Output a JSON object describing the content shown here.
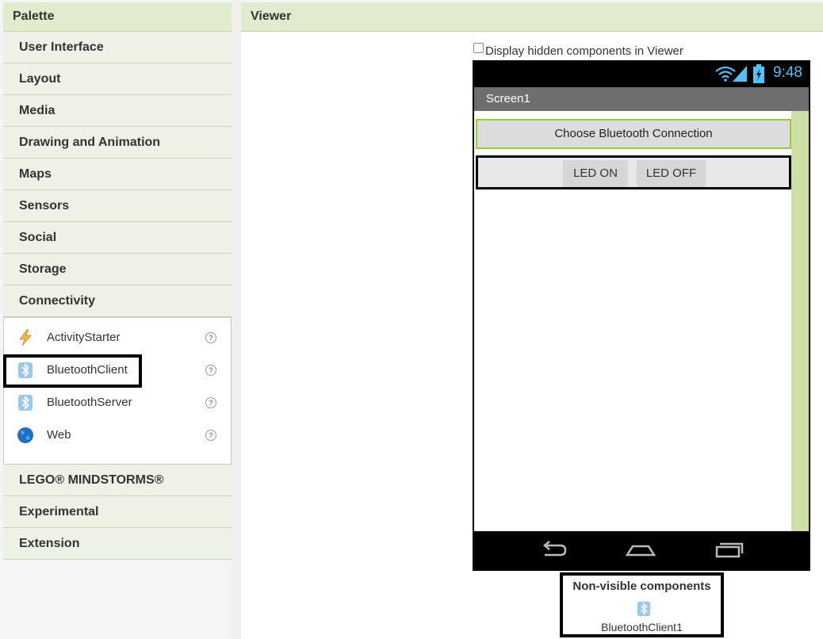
{
  "palette": {
    "title": "Palette",
    "categories_top": [
      "User Interface",
      "Layout",
      "Media",
      "Drawing and Animation",
      "Maps",
      "Sensors",
      "Social",
      "Storage",
      "Connectivity"
    ],
    "connectivity_items": [
      {
        "label": "ActivityStarter",
        "icon": "lightning-icon",
        "help": "?"
      },
      {
        "label": "BluetoothClient",
        "icon": "bluetooth-icon",
        "help": "?"
      },
      {
        "label": "BluetoothServer",
        "icon": "bluetooth-icon",
        "help": "?"
      },
      {
        "label": "Web",
        "icon": "globe-icon",
        "help": "?"
      }
    ],
    "categories_bottom": [
      "LEGO® MINDSTORMS®",
      "Experimental",
      "Extension"
    ]
  },
  "viewer": {
    "title": "Viewer",
    "hidden_checkbox_label": "Display hidden components in Viewer",
    "hidden_checked": false
  },
  "phone": {
    "time": "9:48",
    "screen_title": "Screen1",
    "choose_button": "Choose Bluetooth Connection",
    "led_on": "LED ON",
    "led_off": "LED OFF"
  },
  "nonvisible": {
    "title": "Non-visible components",
    "component_label": "BluetoothClient1",
    "component_icon": "bluetooth-icon"
  },
  "colors": {
    "header_bg": "#e0eccd",
    "category_bg": "#eef2e6",
    "accent_green": "#99cc33",
    "status_blue": "#4fc3f7"
  }
}
